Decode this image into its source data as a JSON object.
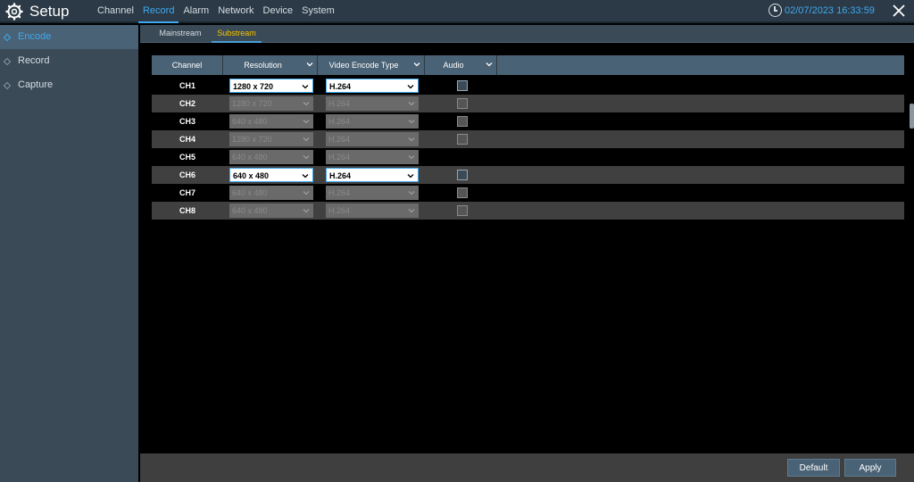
{
  "header": {
    "title": "Setup",
    "nav": [
      "Channel",
      "Record",
      "Alarm",
      "Network",
      "Device",
      "System"
    ],
    "active_nav": "Record",
    "datetime": "02/07/2023 16:33:59",
    "logo_icon": "gear-icon",
    "clock_icon": "clock-icon",
    "close_icon": "close-icon"
  },
  "sidebar": {
    "items": [
      {
        "label": "Encode",
        "active": true
      },
      {
        "label": "Record",
        "active": false
      },
      {
        "label": "Capture",
        "active": false
      }
    ]
  },
  "subtabs": [
    {
      "label": "Mainstream",
      "active": false
    },
    {
      "label": "Substream",
      "active": true
    }
  ],
  "table": {
    "headers": [
      "Channel",
      "Resolution",
      "Video Encode Type",
      "Audio"
    ],
    "rows": [
      {
        "channel": "CH1",
        "resolution": "1280 x 720",
        "encode": "H.264",
        "audio": "unchecked",
        "enabled": true
      },
      {
        "channel": "CH2",
        "resolution": "1280 x 720",
        "encode": "H.264",
        "audio": "unchecked",
        "enabled": false
      },
      {
        "channel": "CH3",
        "resolution": "640 x 480",
        "encode": "H.264",
        "audio": "unchecked",
        "enabled": false
      },
      {
        "channel": "CH4",
        "resolution": "1280 x 720",
        "encode": "H.264",
        "audio": "unchecked",
        "enabled": false
      },
      {
        "channel": "CH5",
        "resolution": "640 x 480",
        "encode": "H.264",
        "audio": null,
        "enabled": false
      },
      {
        "channel": "CH6",
        "resolution": "640 x 480",
        "encode": "H.264",
        "audio": "unchecked",
        "enabled": true
      },
      {
        "channel": "CH7",
        "resolution": "640 x 480",
        "encode": "H.264",
        "audio": "unchecked",
        "enabled": false
      },
      {
        "channel": "CH8",
        "resolution": "640 x 480",
        "encode": "H.264",
        "audio": "unchecked",
        "enabled": false
      }
    ]
  },
  "footer": {
    "default_label": "Default",
    "apply_label": "Apply"
  },
  "colors": {
    "accent": "#3fa9ef",
    "active_subtab": "#f5c400",
    "header_bg": "#2b3a46",
    "table_header_bg": "#4a6275"
  }
}
